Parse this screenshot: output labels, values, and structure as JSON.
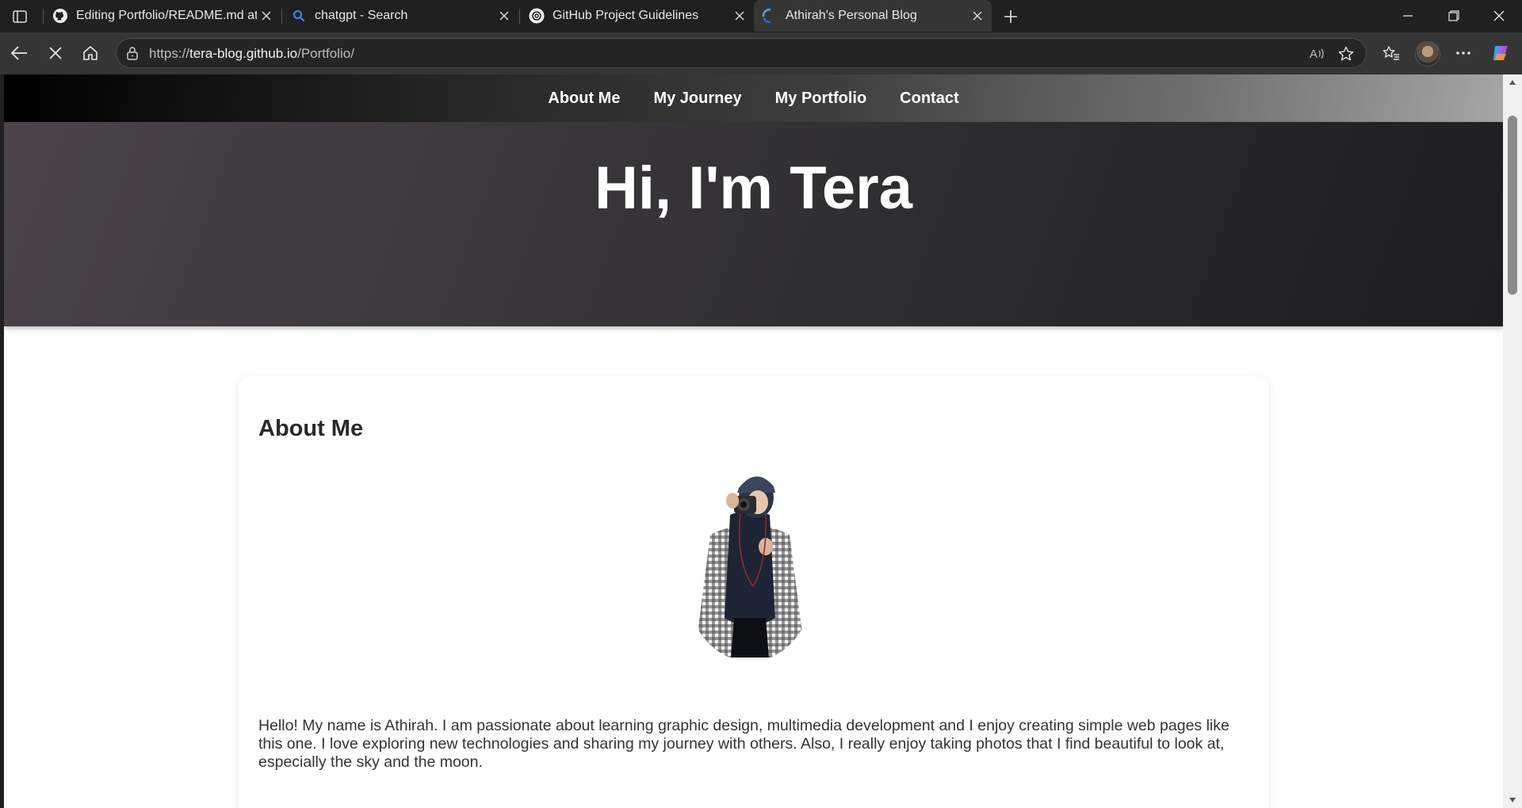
{
  "browser": {
    "tabs": [
      {
        "title": "Editing Portfolio/README.md at m",
        "icon": "github-icon",
        "active": false
      },
      {
        "title": "chatgpt - Search",
        "icon": "search-icon",
        "active": false
      },
      {
        "title": "GitHub Project Guidelines",
        "icon": "openai-icon",
        "active": false
      },
      {
        "title": "Athirah's Personal Blog",
        "icon": "loading-icon",
        "active": true
      }
    ],
    "address": {
      "scheme": "https://",
      "host": "tera-blog.github.io",
      "path": "/Portfolio/"
    },
    "colors": {
      "frame": "#202020",
      "toolbar": "#353535",
      "accent": "#1a73e8"
    }
  },
  "site": {
    "nav": [
      "About Me",
      "My Journey",
      "My Portfolio",
      "Contact"
    ],
    "hero_title": "Hi, I'm Tera",
    "about": {
      "heading": "About Me",
      "text": "Hello! My name is Athirah. I am passionate about learning graphic design, multimedia development and I enjoy creating simple web pages like this one. I love exploring new technologies and sharing my journey with others. Also, I really enjoy taking photos that I find beautiful to look at, especially the sky and the moon."
    }
  }
}
